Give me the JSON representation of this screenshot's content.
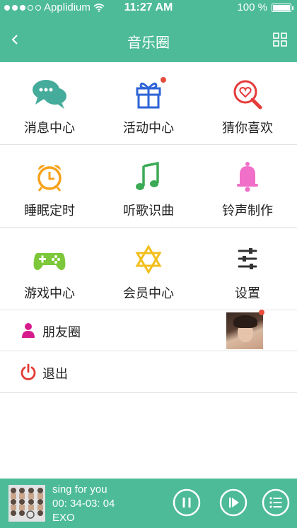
{
  "status": {
    "carrier": "Applidium",
    "time": "11:27 AM",
    "battery": "100 %"
  },
  "nav": {
    "title": "音乐圈"
  },
  "grid": [
    [
      {
        "label": "消息中心",
        "icon": "chat-bubbles-icon",
        "color": "#45ab9b"
      },
      {
        "label": "活动中心",
        "icon": "gift-icon",
        "color": "#2d63d6",
        "badge": true
      },
      {
        "label": "猜你喜欢",
        "icon": "heart-magnifier-icon",
        "color": "#e53b3b"
      }
    ],
    [
      {
        "label": "睡眠定时",
        "icon": "alarm-clock-icon",
        "color": "#f7a21b"
      },
      {
        "label": "听歌识曲",
        "icon": "music-note-icon",
        "color": "#3aaa55"
      },
      {
        "label": "铃声制作",
        "icon": "bell-icon",
        "color": "#f06fc9"
      }
    ],
    [
      {
        "label": "游戏中心",
        "icon": "gamepad-icon",
        "color": "#7cc83a"
      },
      {
        "label": "会员中心",
        "icon": "star-of-david-icon",
        "color": "#f2bf1d"
      },
      {
        "label": "设置",
        "icon": "settings-sliders-icon",
        "color": "#333333"
      }
    ]
  ],
  "list": {
    "friends": {
      "label": "朋友圈",
      "icon": "person-icon",
      "color": "#d81b8c"
    },
    "logout": {
      "label": "退出",
      "icon": "power-icon",
      "color": "#e53935"
    }
  },
  "player": {
    "song": "sing for you",
    "time": "00: 34-03: 04",
    "artist": "EXO"
  },
  "colors": {
    "accent": "#4dbb97",
    "badge": "#e74c3c"
  }
}
